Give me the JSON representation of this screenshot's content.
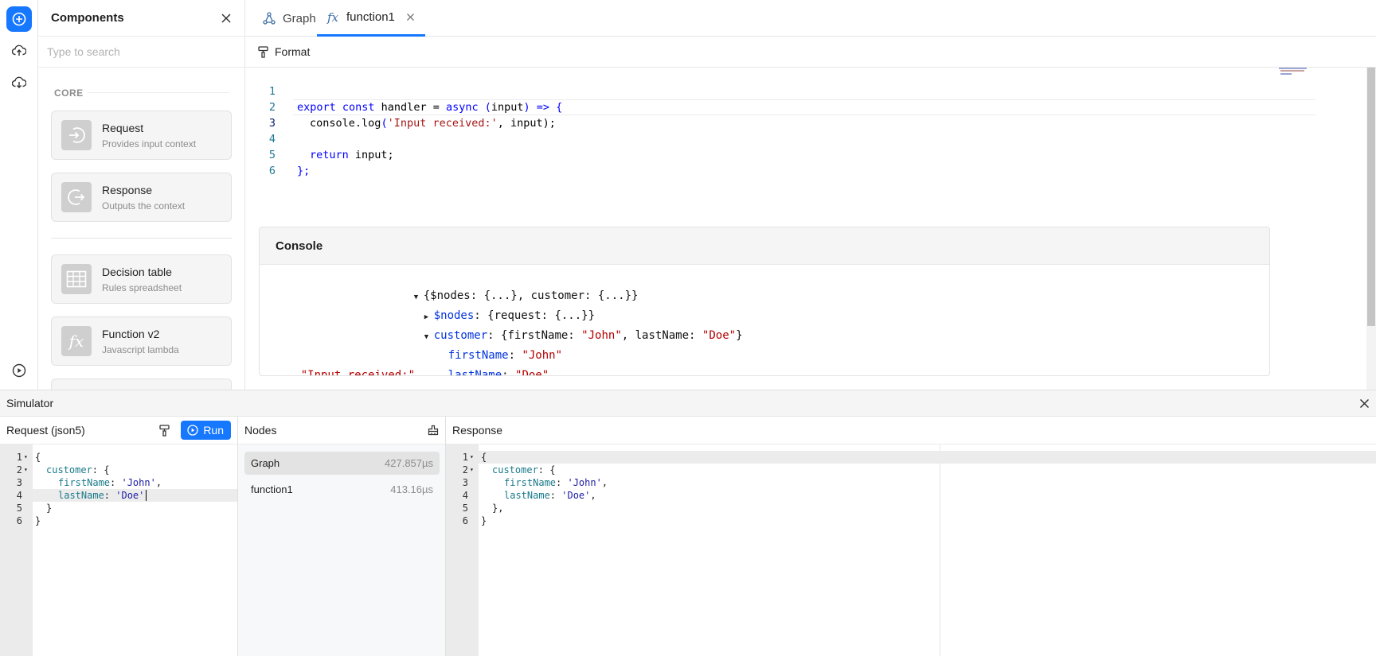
{
  "rail": {
    "icons": [
      "add-icon",
      "cloud-upload-icon",
      "cloud-download-icon",
      "play-circle-icon"
    ]
  },
  "components": {
    "title": "Components",
    "search_placeholder": "Type to search",
    "section_label": "CORE",
    "items": [
      {
        "title": "Request",
        "subtitle": "Provides input context",
        "icon": "login-arrow-icon"
      },
      {
        "title": "Response",
        "subtitle": "Outputs the context",
        "icon": "logout-arrow-icon"
      },
      {
        "title": "Decision table",
        "subtitle": "Rules spreadsheet",
        "icon": "table-icon"
      },
      {
        "title": "Function v2",
        "subtitle": "Javascript lambda",
        "icon": "fx-icon"
      }
    ]
  },
  "tabs": [
    {
      "label": "Graph",
      "icon": "graph-icon",
      "active": false
    },
    {
      "label": "function1",
      "icon": "fx-icon",
      "active": true
    }
  ],
  "format_label": "Format",
  "editor": {
    "line_numbers": [
      "1",
      "2",
      "3",
      "4",
      "5",
      "6"
    ],
    "lines": {
      "l1": {
        "a": "export const",
        "b": " handler ",
        "c": "=",
        "d": " async ",
        "e": "(",
        "f": "input",
        "g": ") => {"
      },
      "l2": {
        "a": "console",
        "b": ".",
        "c": "log",
        "d": "(",
        "e": "'Input received:'",
        "f": ", input",
        "g": ");"
      },
      "l4": {
        "a": "return",
        "b": " input;"
      },
      "l5": {
        "a": "};"
      }
    }
  },
  "console": {
    "title": "Console",
    "root_summary": "{$nodes: {...}, customer: {...}}",
    "nodes_key": "$nodes",
    "nodes_value": ": {request: {...}}",
    "customer_key": "customer",
    "customer_value_pre": ": {firstName: ",
    "customer_first": "\"John\"",
    "customer_mid": ", lastName: ",
    "customer_last": "\"Doe\"",
    "customer_end": "}",
    "first_key": "firstName",
    "first_val": "\"John\"",
    "last_key": "lastName",
    "last_val": "\"Doe\"",
    "message": "\"Input received:\""
  },
  "simulator": {
    "title": "Simulator",
    "request": {
      "title": "Request (json5)",
      "run_label": "Run",
      "line_numbers": [
        "1",
        "2",
        "3",
        "4",
        "5",
        "6"
      ],
      "lines": {
        "l1": "{",
        "l2k": "customer",
        "l2v": ": {",
        "l3k": "firstName",
        "l3c": ": ",
        "l3v": "'John'",
        "l3e": ",",
        "l4k": "lastName",
        "l4c": ": ",
        "l4v": "'Doe'",
        "l5": "}",
        "l6": "}"
      }
    },
    "nodes": {
      "title": "Nodes",
      "rows": [
        {
          "name": "Graph",
          "time": "427.857µs",
          "selected": true
        },
        {
          "name": "function1",
          "time": "413.16µs",
          "selected": false
        }
      ]
    },
    "response": {
      "title": "Response",
      "line_numbers": [
        "1",
        "2",
        "3",
        "4",
        "5",
        "6"
      ],
      "lines": {
        "l1": "{",
        "l2k": "customer",
        "l2v": ": {",
        "l3k": "firstName",
        "l3c": ": ",
        "l3v": "'John'",
        "l3e": ",",
        "l4k": "lastName",
        "l4c": ": ",
        "l4v": "'Doe'",
        "l4e": ",",
        "l5": "},",
        "l6": "}"
      }
    }
  },
  "colors": {
    "accent": "#1677ff",
    "keyword": "#0000ff",
    "string": "#a31515"
  }
}
